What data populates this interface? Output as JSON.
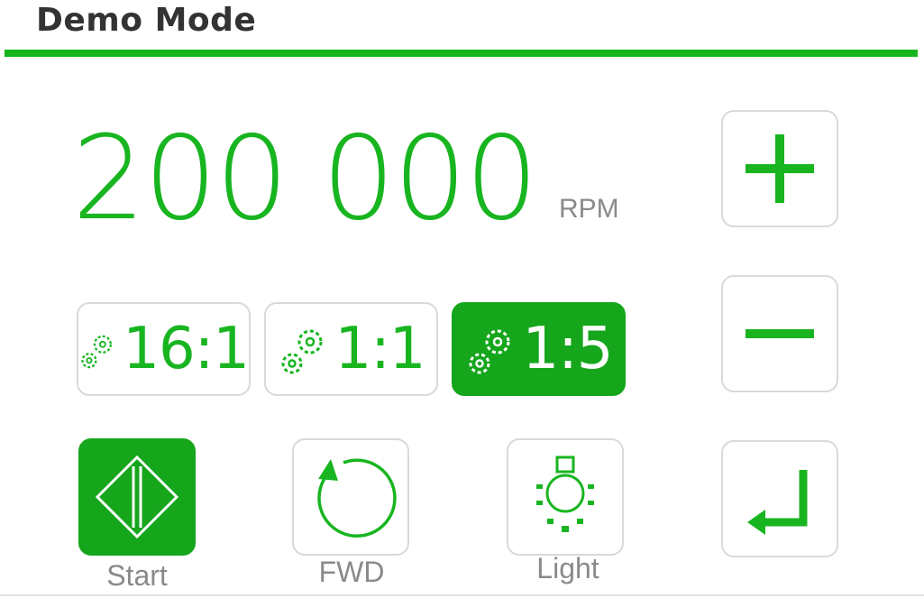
{
  "header": {
    "title": "Demo Mode"
  },
  "speed": {
    "value": "200 000",
    "unit": "RPM"
  },
  "ratios": [
    {
      "label": "16:1",
      "active": false
    },
    {
      "label": "1:1",
      "active": false
    },
    {
      "label": "1:5",
      "active": true
    }
  ],
  "actions": {
    "start_label": "Start",
    "direction_label": "FWD",
    "light_label": "Light"
  },
  "icons": {
    "increase": "plus-icon",
    "decrease": "minus-icon",
    "enter": "enter-icon",
    "start": "start-diamond-icon",
    "direction": "circular-arrow-icon",
    "light": "light-bulb-icon",
    "ratio": "gears-icon"
  },
  "colors": {
    "accent": "#18b520",
    "active_fill": "#15a61b",
    "border": "#d9d9d9",
    "label_gray": "#8a8a8a",
    "title": "#333333"
  }
}
